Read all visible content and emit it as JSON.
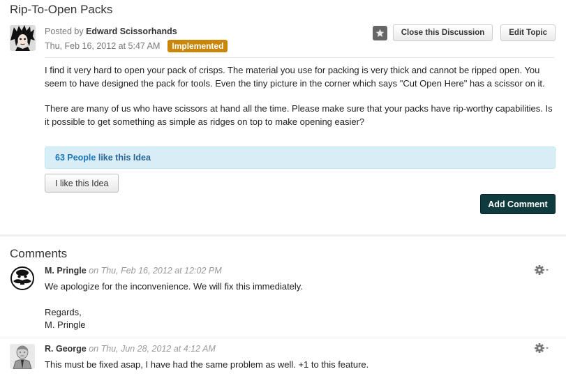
{
  "topic": {
    "title": "Rip-To-Open Packs",
    "posted_by_prefix": "Posted by",
    "author": "Edward Scissorhands",
    "date": "Thu, Feb 16, 2012 at 5:47 AM",
    "status": "Implemented",
    "body": [
      "I find it very hard to open your pack of crisps. The material you use for packing is very thick and cannot be ripped open. You seem to have designed the pack for tools. Even the tiny picture in the corner which says \"Cut Open Here\" has a scissor on it.",
      "There are many of us who have scissors at hand all the time. Please make sure that your packs have rip-worthy capabilities. Is it possible to get something as simple as ridges on top to make opening easier?"
    ]
  },
  "actions": {
    "close_label": "Close this Discussion",
    "edit_label": "Edit Topic"
  },
  "likes": {
    "count_text": "63 People",
    "suffix": "like this Idea",
    "like_button": "I like this Idea"
  },
  "add_comment_label": "Add Comment",
  "comments_heading": "Comments",
  "comments": [
    {
      "author": "M. Pringle",
      "date": "on Thu, Feb 16, 2012 at 12:02 PM",
      "body": [
        "We apologize for the inconvenience. We will fix this immediately.",
        "Regards,",
        "M. Pringle"
      ]
    },
    {
      "author": "R. George",
      "date": "on Thu, Jun 28, 2012 at 4:12 AM",
      "body": [
        "This must be fixed asap, I have had the same problem as well. +1 to this feature."
      ]
    }
  ],
  "colors": {
    "status_badge": "#c8860b",
    "likes_bg": "#d9edf7",
    "likes_text": "#1a75bb",
    "add_comment_bg": "#0f3b3f"
  },
  "icons": {
    "star": "star-icon",
    "gear": "gear-icon"
  }
}
